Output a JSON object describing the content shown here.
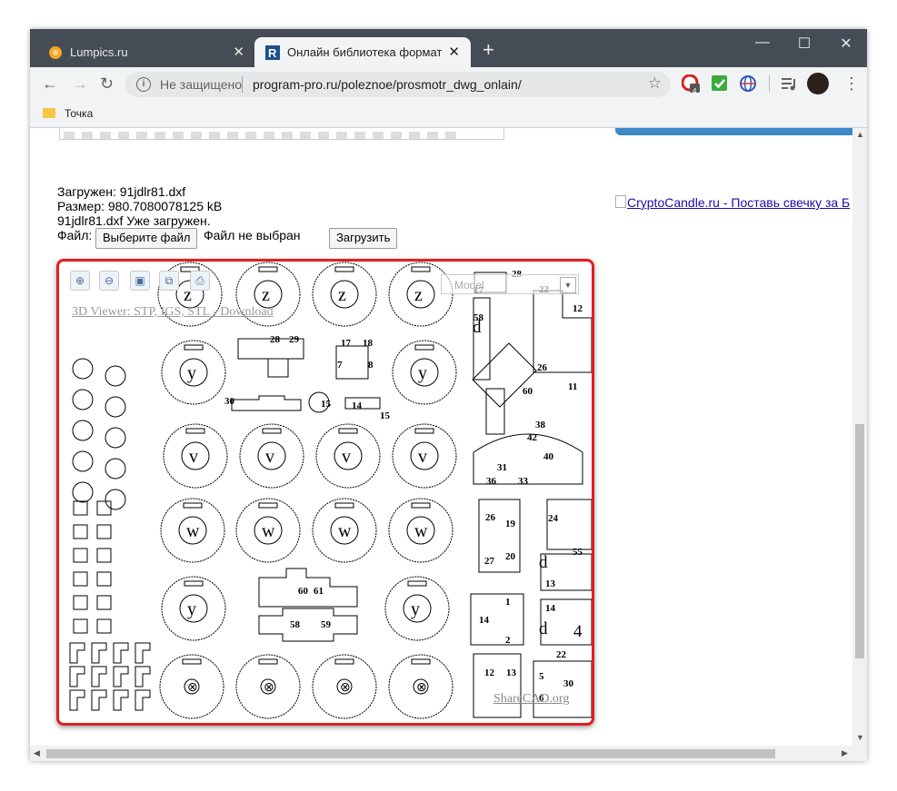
{
  "browser": {
    "tabs": [
      {
        "title": "Lumpics.ru",
        "close": "✕"
      },
      {
        "title": "Онлайн библиотека форматов",
        "close": "✕"
      }
    ],
    "new_tab": "+",
    "window_controls": {
      "minimize": "—",
      "maximize": "☐",
      "close": "✕"
    },
    "nav": {
      "back": "←",
      "forward": "→",
      "reload": "↻"
    },
    "address": {
      "security": "Не защищено",
      "url": "program-pro.ru/poleznoe/prosmotr_dwg_onlain/",
      "info": "i",
      "star": "☆"
    },
    "extension_badge": "4",
    "menu": "⋮",
    "bookmark": "Точка"
  },
  "page": {
    "loaded": "Загружен: 91jdlr81.dxf",
    "size": "Размер: 980.7080078125 kB",
    "already": "91jdlr81.dxf Уже загружен.",
    "file_label": "Файл:",
    "choose_button": "Выберите файл",
    "no_file": "Файл не выбран",
    "upload_button": "Загрузить",
    "side_link": "CryptoCandle.ru - Поставь свечку за Б"
  },
  "viewer": {
    "tools": [
      "zoom-in-icon",
      "zoom-out-icon",
      "fit-icon",
      "layers-icon",
      "print-icon"
    ],
    "link": "3D Viewer: STP, IGS, STL - Download",
    "model_label": "Model",
    "sharecad": "ShareCAD.org",
    "part_letters": [
      "z",
      "z",
      "z",
      "z",
      "y",
      "y",
      "v",
      "v",
      "v",
      "v",
      "w",
      "w",
      "w",
      "w",
      "y",
      "y"
    ]
  }
}
